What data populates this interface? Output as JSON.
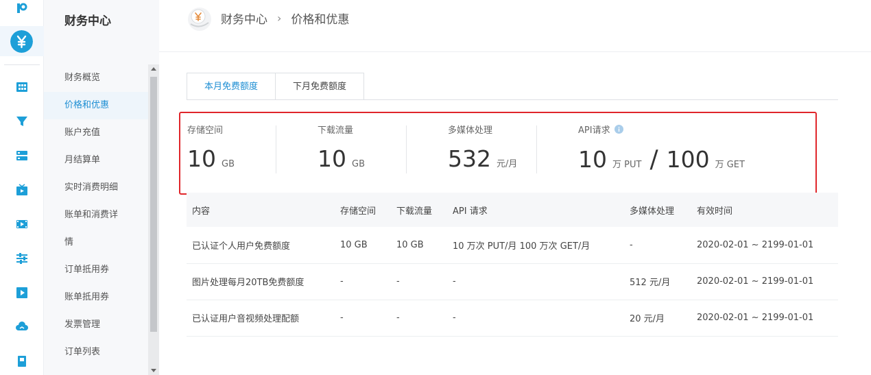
{
  "sidebar": {
    "title": "财务中心",
    "items": [
      {
        "label": "财务概览",
        "active": false
      },
      {
        "label": "价格和优惠",
        "active": true
      },
      {
        "label": "账户充值",
        "active": false
      },
      {
        "label": "月结算单",
        "active": false
      },
      {
        "label": "实时消费明细",
        "active": false
      },
      {
        "label": "账单和消费详",
        "active": false
      },
      {
        "label": "情",
        "active": false
      },
      {
        "label": "订单抵用券",
        "active": false
      },
      {
        "label": "账单抵用券",
        "active": false
      },
      {
        "label": "发票管理",
        "active": false
      },
      {
        "label": "订单列表",
        "active": false
      }
    ]
  },
  "rail_icons": [
    "logo-icon",
    "finance-icon",
    "dashboard-icon",
    "funnel-icon",
    "storage-icon",
    "live-icon",
    "video-icon",
    "sliders-icon",
    "player-icon",
    "cloud-icon",
    "document-icon"
  ],
  "breadcrumb": {
    "root": "财务中心",
    "current": "价格和优惠"
  },
  "tabs": [
    {
      "label": "本月免费额度",
      "active": true
    },
    {
      "label": "下月免费额度",
      "active": false
    }
  ],
  "quota": {
    "storage": {
      "label": "存储空间",
      "value": "10",
      "unit": "GB"
    },
    "download": {
      "label": "下载流量",
      "value": "10",
      "unit": "GB"
    },
    "media": {
      "label": "多媒体处理",
      "value": "532",
      "unit": "元/月"
    },
    "api": {
      "label": "API请求",
      "put_value": "10",
      "put_unit": "万 PUT",
      "slash": "/",
      "get_value": "100",
      "get_unit": "万 GET"
    }
  },
  "table": {
    "headers": [
      "内容",
      "存储空间",
      "下载流量",
      "API 请求",
      "多媒体处理",
      "有效时间"
    ],
    "rows": [
      [
        "已认证个人用户免费额度",
        "10 GB",
        "10 GB",
        "10 万次 PUT/月 100 万次 GET/月",
        "-",
        "2020-02-01 ~ 2199-01-01"
      ],
      [
        "图片处理每月20TB免费额度",
        "-",
        "-",
        "-",
        "512 元/月",
        "2020-02-01 ~ 2199-01-01"
      ],
      [
        "已认证用户音视频处理配额",
        "-",
        "-",
        "-",
        "20 元/月",
        "2020-02-01 ~ 2199-01-01"
      ]
    ]
  },
  "colors": {
    "accent": "#1d8ed3",
    "highlight_border": "#e0252a",
    "icon_blue": "#1d9fd8"
  }
}
